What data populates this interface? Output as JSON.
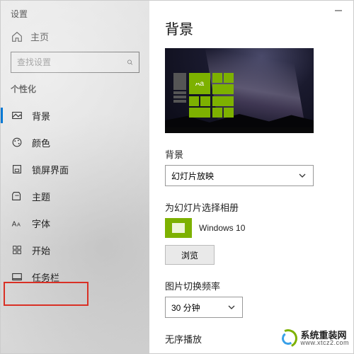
{
  "window": {
    "title": "设置"
  },
  "sidebar": {
    "home_label": "主页",
    "search_placeholder": "查找设置",
    "section_label": "个性化",
    "items": [
      {
        "label": "背景"
      },
      {
        "label": "颜色"
      },
      {
        "label": "锁屏界面"
      },
      {
        "label": "主题"
      },
      {
        "label": "字体"
      },
      {
        "label": "开始"
      },
      {
        "label": "任务栏"
      }
    ]
  },
  "main": {
    "heading": "背景",
    "preview_sample_text": "Aa",
    "bg_label": "背景",
    "bg_dropdown_value": "幻灯片放映",
    "album_label": "为幻灯片选择相册",
    "album_name": "Windows 10",
    "browse_label": "浏览",
    "interval_label": "图片切换频率",
    "interval_value": "30 分钟",
    "shuffle_label": "无序播放"
  },
  "watermark": {
    "text": "系统重装网",
    "url": "www.xtcz2.com"
  }
}
